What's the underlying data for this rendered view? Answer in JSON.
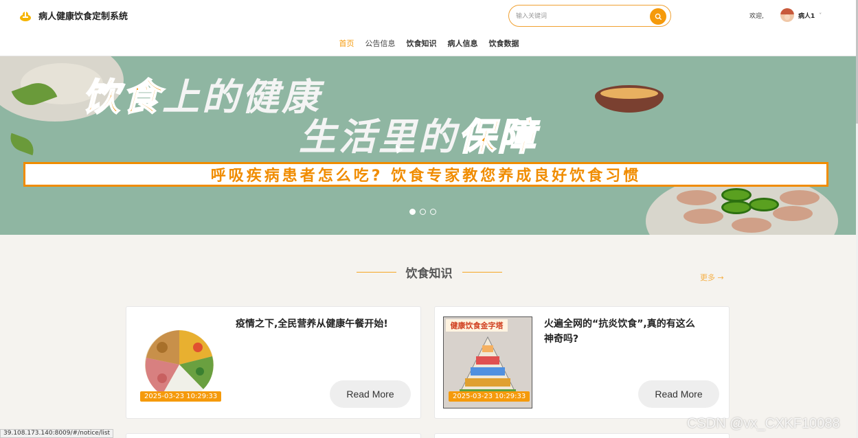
{
  "header": {
    "site_title": "病人健康饮食定制系统",
    "search_placeholder": "输入关键词",
    "welcome": "欢迎,",
    "user_name": "病人1",
    "user_caret": "˅"
  },
  "nav": {
    "items": [
      {
        "label": "首页",
        "active": true
      },
      {
        "label": "公告信息",
        "active": false
      },
      {
        "label": "饮食知识",
        "active": false
      },
      {
        "label": "病人信息",
        "active": false
      },
      {
        "label": "饮食数据",
        "active": false
      }
    ]
  },
  "banner": {
    "line1_highlight": "饮食",
    "line1_plain": "上的健康",
    "line2_plain": "生活里的",
    "line2_highlight": "保障",
    "subtitle": "呼吸疾病患者怎么吃? 饮食专家教您养成良好饮食习惯",
    "slides": 3,
    "active_slide": 1
  },
  "section": {
    "title": "饮食知识",
    "more_label": "更多 →"
  },
  "cards": [
    {
      "title": "疫情之下,全民营养从健康午餐开始!",
      "date": "2025-03-23 10:29:33",
      "read_more": "Read More"
    },
    {
      "title": "火遍全网的“抗炎饮食”,真的有这么神奇吗?",
      "date": "2025-03-23 10:29:33",
      "read_more": "Read More",
      "image_label": "健康饮食金字塔"
    }
  ],
  "status_bar": {
    "url": "39.108.173.140:8009/#/notice/list"
  },
  "watermark": "CSDN @vx_CXKF10088",
  "colors": {
    "accent": "#f59a0b",
    "banner_bg": "#8fb6a2"
  }
}
